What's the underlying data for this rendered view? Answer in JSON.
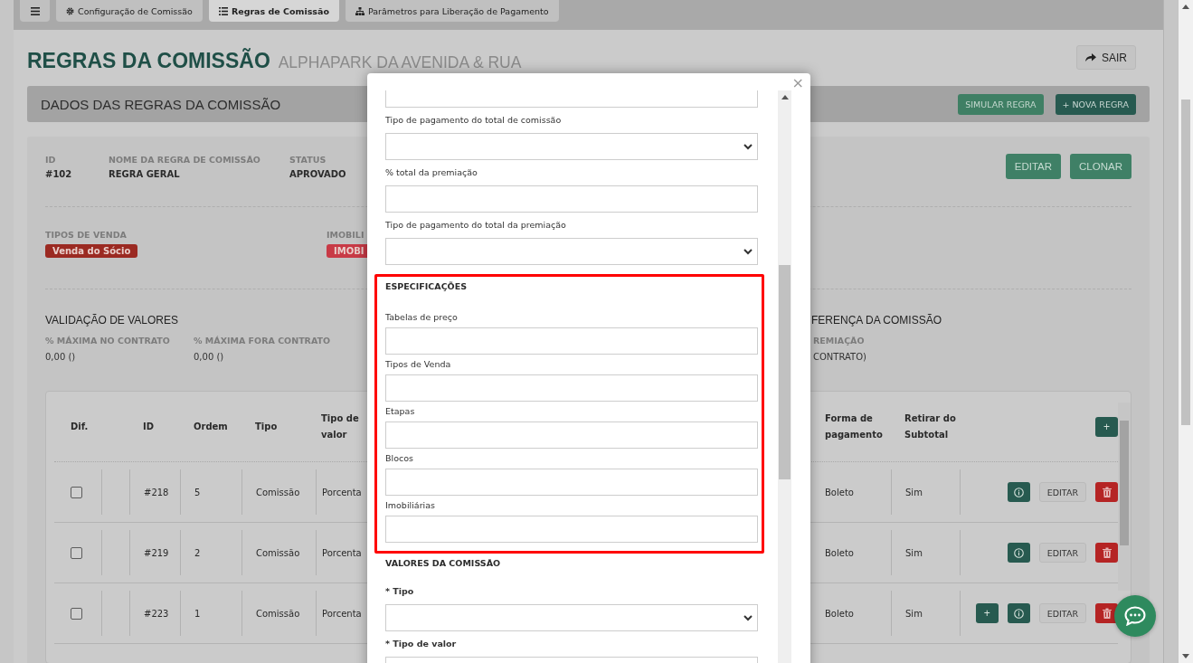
{
  "tabs": [
    {
      "kind": "menu",
      "selected": false
    },
    {
      "kind": "tab",
      "label": "Configuração de Comissão",
      "selected": false
    },
    {
      "kind": "tab",
      "label": "Regras de Comissão",
      "selected": true
    },
    {
      "kind": "tab",
      "label": "Parâmetros para Liberação de Pagamento",
      "selected": false
    }
  ],
  "page": {
    "title": "REGRAS DA COMISSÃO",
    "subtitle": "ALPHAPARK DA AVENIDA & RUA",
    "exit_button": "SAIR"
  },
  "panel": {
    "title": "DADOS DAS REGRAS DA COMISSÃO",
    "buttons": [
      {
        "kind": "light",
        "label": "SIMULAR REGRA"
      },
      {
        "kind": "dark",
        "label": "+ NOVA REGRA"
      }
    ]
  },
  "rule": {
    "fields": [
      {
        "label": "ID",
        "value": "#102"
      },
      {
        "label": "NOME DA REGRA DE COMISSÃO",
        "value": "REGRA GERAL"
      },
      {
        "label": "STATUS",
        "value": "APROVADO"
      }
    ],
    "buttons": [
      "EDITAR",
      "CLONAR"
    ],
    "tag_groups": [
      {
        "label": "TIPOS DE VENDA",
        "badges": [
          {
            "text": "Venda do Sócio",
            "color": "#9b2a22"
          }
        ]
      },
      {
        "label": "IMOBILI",
        "badges": [
          {
            "text": "IMOBI",
            "color": "#c83a46"
          }
        ]
      }
    ],
    "validation": {
      "title": "VALIDAÇÃO DE VALORES",
      "fields": [
        {
          "label": "% MÁXIMA NO CONTRATO",
          "value": "0,00 ()"
        },
        {
          "label": "% MÁXIMA FORA CONTRATO",
          "value": "0,00 ()"
        }
      ]
    },
    "difference": {
      "title": "FERENÇA DA COMISSÃO",
      "label": "REMIAÇÃO",
      "value": "CONTRATO)"
    }
  },
  "table": {
    "columns_left": [
      "Dif.",
      "ID",
      "Ordem",
      "Tipo",
      "Tipo de valor"
    ],
    "columns_right": [
      "Forma de pagamento",
      "Retirar do Subtotal"
    ],
    "add_button": "+",
    "rows": [
      {
        "checked": false,
        "id": "#218",
        "order": "5",
        "type": "Comissão",
        "value_type": "Porcenta",
        "payment": "Boleto",
        "remove": "Sim",
        "actions": [
          {
            "kind": "info"
          },
          {
            "kind": "edit",
            "label": "EDITAR"
          },
          {
            "kind": "delete"
          }
        ]
      },
      {
        "checked": false,
        "id": "#219",
        "order": "2",
        "type": "Comissão",
        "value_type": "Porcenta",
        "payment": "Boleto",
        "remove": "Sim",
        "actions": [
          {
            "kind": "info"
          },
          {
            "kind": "edit",
            "label": "EDITAR"
          },
          {
            "kind": "delete"
          }
        ]
      },
      {
        "checked": false,
        "id": "#223",
        "order": "1",
        "type": "Comissão",
        "value_type": "Porcenta",
        "payment": "Boleto",
        "remove": "Sim",
        "actions": [
          {
            "kind": "add",
            "label": "+"
          },
          {
            "kind": "info"
          },
          {
            "kind": "edit",
            "label": "EDITAR"
          },
          {
            "kind": "delete"
          }
        ]
      }
    ]
  },
  "modal": {
    "close": "×",
    "sections": [
      {
        "highlighted": false,
        "fields": [
          {
            "kind": "input"
          },
          {
            "kind": "select",
            "label": "Tipo de pagamento do total de comissão",
            "required": false
          },
          {
            "kind": "input",
            "label": "% total da premiação",
            "required": false
          },
          {
            "kind": "select",
            "label": "Tipo de pagamento do total da premiação",
            "required": false
          }
        ]
      },
      {
        "highlighted": true,
        "title": "ESPECIFICAÇÕES",
        "fields": [
          {
            "kind": "input",
            "label": "Tabelas de preço",
            "required": false
          },
          {
            "kind": "input",
            "label": "Tipos de Venda",
            "required": false
          },
          {
            "kind": "input",
            "label": "Etapas",
            "required": false
          },
          {
            "kind": "input",
            "label": "Blocos",
            "required": false
          },
          {
            "kind": "input",
            "label": "Imobiliárias",
            "required": false
          }
        ]
      },
      {
        "highlighted": false,
        "title": "VALORES DA COMISSÃO",
        "fields": [
          {
            "kind": "select",
            "label": "* Tipo",
            "required": true
          },
          {
            "kind": "select",
            "label": "* Tipo de valor",
            "required": true
          }
        ]
      }
    ]
  }
}
